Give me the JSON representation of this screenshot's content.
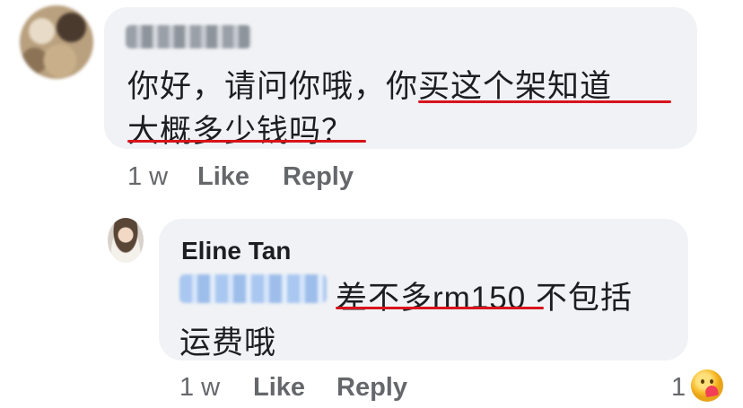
{
  "comment": {
    "line1": "你好，请问你哦，你买这个架知道",
    "line2": "大概多少钱吗？",
    "time": "1 w",
    "like_label": "Like",
    "reply_label": "Reply"
  },
  "reply": {
    "author": "Eline Tan",
    "line1": "差不多rm150 不包括",
    "line2": "运费哦",
    "time": "1 w",
    "like_label": "Like",
    "reply_label": "Reply",
    "reaction_count": "1",
    "reaction_icon": "care-reaction-icon"
  },
  "colors": {
    "bubble": "#f0f2f5",
    "underline": "#d9131c",
    "meta_text": "#65676b"
  }
}
